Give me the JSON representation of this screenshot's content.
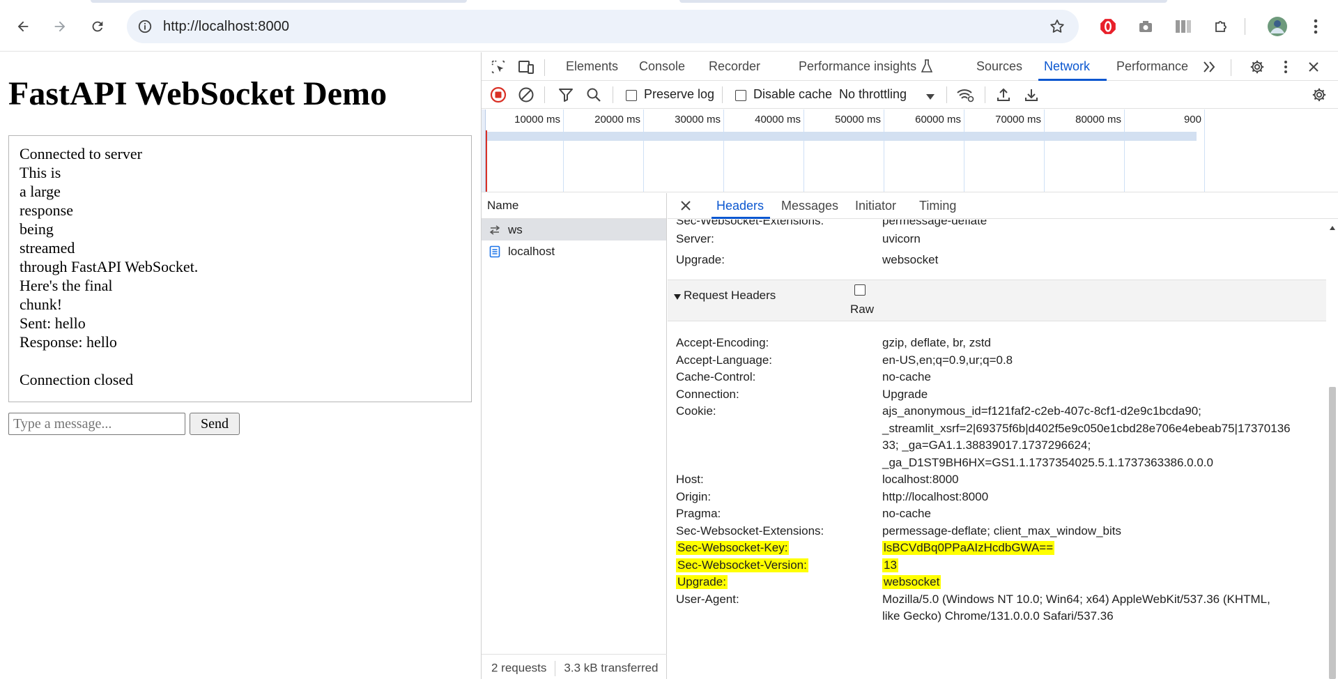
{
  "browser": {
    "url": "http://localhost:8000",
    "icons": [
      "back-arrow-icon",
      "forward-arrow-icon",
      "reload-icon",
      "site-info-icon",
      "bookmark-star-icon",
      "opera-extension-icon",
      "camera-extension-icon",
      "reading-mode-icon",
      "extensions-puzzle-icon",
      "profile-avatar",
      "kebab-menu-icon"
    ]
  },
  "page": {
    "title": "FastAPI WebSocket Demo",
    "log_lines": [
      "Connected to server",
      "This is",
      "a large",
      "response",
      "being",
      "streamed",
      "through FastAPI WebSocket.",
      "Here's the final",
      "chunk!",
      "Sent: hello",
      "Response: hello",
      "",
      "Connection closed"
    ],
    "input_placeholder": "Type a message...",
    "send_label": "Send"
  },
  "devtools": {
    "tabs": [
      "Elements",
      "Console",
      "Recorder",
      "Performance insights",
      "Sources",
      "Network",
      "Performance"
    ],
    "active_tab": "Network",
    "toolbar": {
      "preserve_log": "Preserve log",
      "disable_cache": "Disable cache",
      "throttling": "No throttling"
    },
    "timeline_ticks": [
      "10000 ms",
      "20000 ms",
      "30000 ms",
      "40000 ms",
      "50000 ms",
      "60000 ms",
      "70000 ms",
      "80000 ms",
      "900"
    ],
    "name_header": "Name",
    "requests": [
      {
        "name": "ws",
        "icon": "websocket-arrows-icon"
      },
      {
        "name": "localhost",
        "icon": "document-icon"
      }
    ],
    "status": {
      "requests": "2 requests",
      "transferred": "3.3 kB transferred"
    },
    "detail_tabs": [
      "Headers",
      "Messages",
      "Initiator",
      "Timing"
    ],
    "active_detail_tab": "Headers",
    "response_headers_partial": [
      {
        "key": "Sec-Websocket-Extensions:",
        "value": "permessage-deflate"
      },
      {
        "key": "Server:",
        "value": "uvicorn"
      },
      {
        "key": "Upgrade:",
        "value": "websocket"
      }
    ],
    "request_headers_title": "Request Headers",
    "raw_label": "Raw",
    "request_headers": [
      {
        "key": "Accept-Encoding:",
        "value": "gzip, deflate, br, zstd",
        "highlight": false
      },
      {
        "key": "Accept-Language:",
        "value": "en-US,en;q=0.9,ur;q=0.8",
        "highlight": false
      },
      {
        "key": "Cache-Control:",
        "value": "no-cache",
        "highlight": false
      },
      {
        "key": "Connection:",
        "value": "Upgrade",
        "highlight": false
      },
      {
        "key": "Cookie:",
        "value_lines": [
          "ajs_anonymous_id=f121faf2-c2eb-407c-8cf1-d2e9c1bcda90;",
          "_streamlit_xsrf=2|69375f6b|d402f5e9c050e1cbd28e706e4ebeab75|17370136",
          "33; _ga=GA1.1.38839017.1737296624;",
          "_ga_D1ST9BH6HX=GS1.1.1737354025.5.1.1737363386.0.0.0"
        ],
        "highlight": false
      },
      {
        "key": "Host:",
        "value": "localhost:8000",
        "highlight": false
      },
      {
        "key": "Origin:",
        "value": "http://localhost:8000",
        "highlight": false
      },
      {
        "key": "Pragma:",
        "value": "no-cache",
        "highlight": false
      },
      {
        "key": "Sec-Websocket-Extensions:",
        "value": "permessage-deflate; client_max_window_bits",
        "highlight": false
      },
      {
        "key": "Sec-Websocket-Key:",
        "value": "lsBCVdBq0PPaAIzHcdbGWA==",
        "highlight": true
      },
      {
        "key": "Sec-Websocket-Version:",
        "value": "13",
        "highlight": true
      },
      {
        "key": "Upgrade:",
        "value": "websocket",
        "highlight": true
      },
      {
        "key": "User-Agent:",
        "value_lines": [
          "Mozilla/5.0 (Windows NT 10.0; Win64; x64) AppleWebKit/537.36 (KHTML,",
          "like Gecko) Chrome/131.0.0.0 Safari/537.36"
        ],
        "highlight": false
      }
    ],
    "colors": {
      "accent": "#0b57d0",
      "highlight": "#ffff00",
      "record_red": "#d93025"
    }
  }
}
